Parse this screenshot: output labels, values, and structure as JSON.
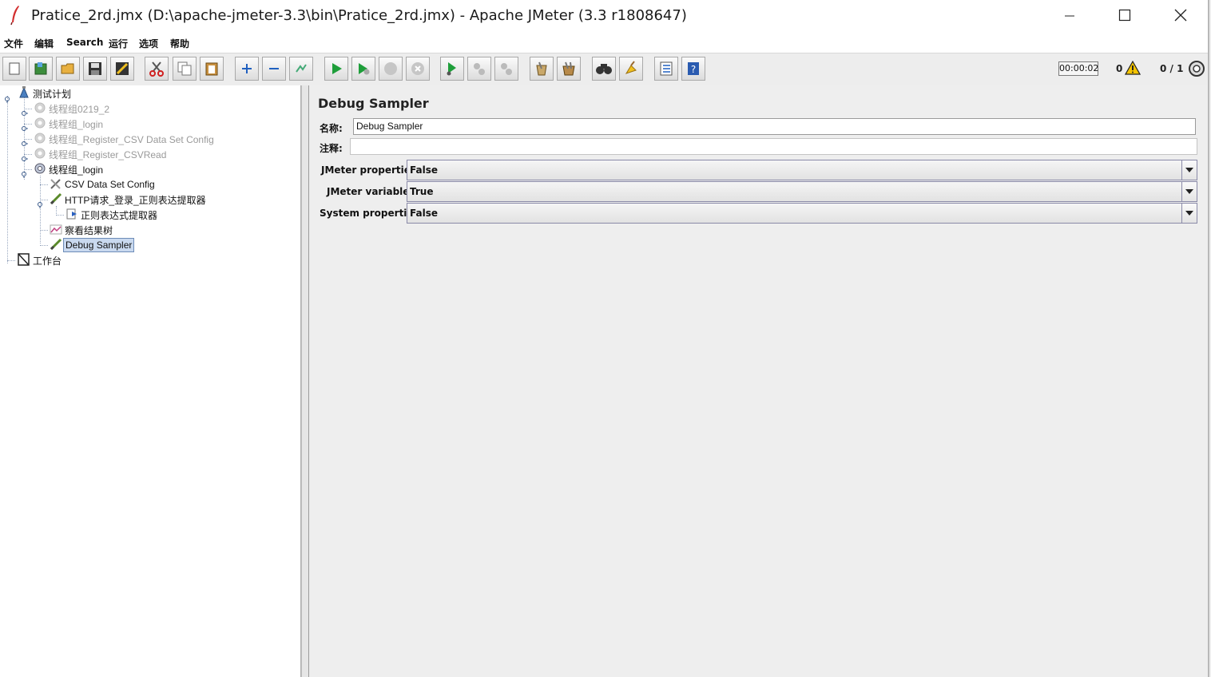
{
  "window": {
    "title": "Pratice_2rd.jmx (D:\\apache-jmeter-3.3\\bin\\Pratice_2rd.jmx) - Apache JMeter (3.3 r1808647)"
  },
  "menu": [
    "文件",
    "编辑",
    "Search",
    "运行",
    "选项",
    "帮助"
  ],
  "toolbar": {
    "buttons": [
      "new-icon",
      "templates-icon",
      "open-icon",
      "save-icon",
      "save-as-icon",
      "cut-icon",
      "copy-icon",
      "paste-icon",
      "expand-icon",
      "collapse-icon",
      "toggle-icon",
      "start-icon",
      "start-no-pause-icon",
      "stop-icon",
      "shutdown-icon",
      "remote-start-icon",
      "remote-stop-icon",
      "remote-shutdown-icon",
      "clear-icon",
      "clear-all-icon",
      "search-icon",
      "reset-search-icon",
      "function-helper-icon",
      "help-icon"
    ],
    "timer": "00:00:02",
    "error_count": "0",
    "threads": "0 / 1"
  },
  "tree": {
    "nodes": [
      {
        "label": "测试计划",
        "icon": "test-plan-icon",
        "state": "normal"
      },
      {
        "label": "线程组0219_2",
        "icon": "thread-group-icon",
        "state": "disabled"
      },
      {
        "label": "线程组_login",
        "icon": "thread-group-icon",
        "state": "disabled"
      },
      {
        "label": "线程组_Register_CSV Data Set Config",
        "icon": "thread-group-icon",
        "state": "disabled"
      },
      {
        "label": "线程组_Register_CSVRead",
        "icon": "thread-group-icon",
        "state": "disabled"
      },
      {
        "label": "线程组_login",
        "icon": "thread-group-icon",
        "state": "normal"
      },
      {
        "label": "CSV Data Set Config",
        "icon": "config-element-icon",
        "state": "normal"
      },
      {
        "label": "HTTP请求_登录_正则表达提取器",
        "icon": "sampler-icon",
        "state": "normal"
      },
      {
        "label": "正则表达式提取器",
        "icon": "post-processor-icon",
        "state": "normal"
      },
      {
        "label": "察看结果树",
        "icon": "listener-icon",
        "state": "normal"
      },
      {
        "label": "Debug Sampler",
        "icon": "sampler-icon",
        "state": "selected"
      },
      {
        "label": "工作台",
        "icon": "workbench-icon",
        "state": "normal"
      }
    ]
  },
  "panel": {
    "title": "Debug Sampler",
    "name_label": "名称:",
    "name_value": "Debug Sampler",
    "comment_label": "注释:",
    "comment_value": "",
    "fields": [
      {
        "label": "JMeter properties:",
        "value": "False"
      },
      {
        "label": "JMeter variables:",
        "value": "True"
      },
      {
        "label": "System properties:",
        "value": "False"
      }
    ]
  },
  "colors": {
    "selection_bg": "#c9d9ef",
    "disabled_text": "#9a9a9a",
    "play_green": "#1e9e3a"
  }
}
